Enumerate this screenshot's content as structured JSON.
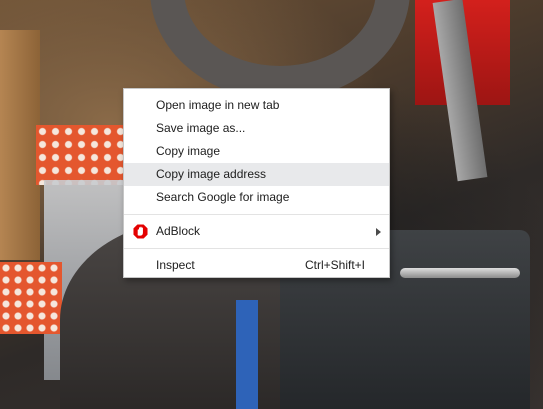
{
  "background": {
    "description_icon": "photo-background"
  },
  "context_menu": {
    "items": [
      {
        "label": "Open image in new tab"
      },
      {
        "label": "Save image as..."
      },
      {
        "label": "Copy image"
      },
      {
        "label": "Copy image address",
        "highlighted": true
      },
      {
        "label": "Search Google for image"
      }
    ],
    "extension_item": {
      "label": "AdBlock",
      "icon": "adblock-hand-icon",
      "submenu_icon": "chevron-right-icon",
      "icon_color": "#e40000"
    },
    "inspect_item": {
      "label": "Inspect",
      "shortcut": "Ctrl+Shift+I"
    },
    "highlight_color": "#e8e9eb"
  }
}
